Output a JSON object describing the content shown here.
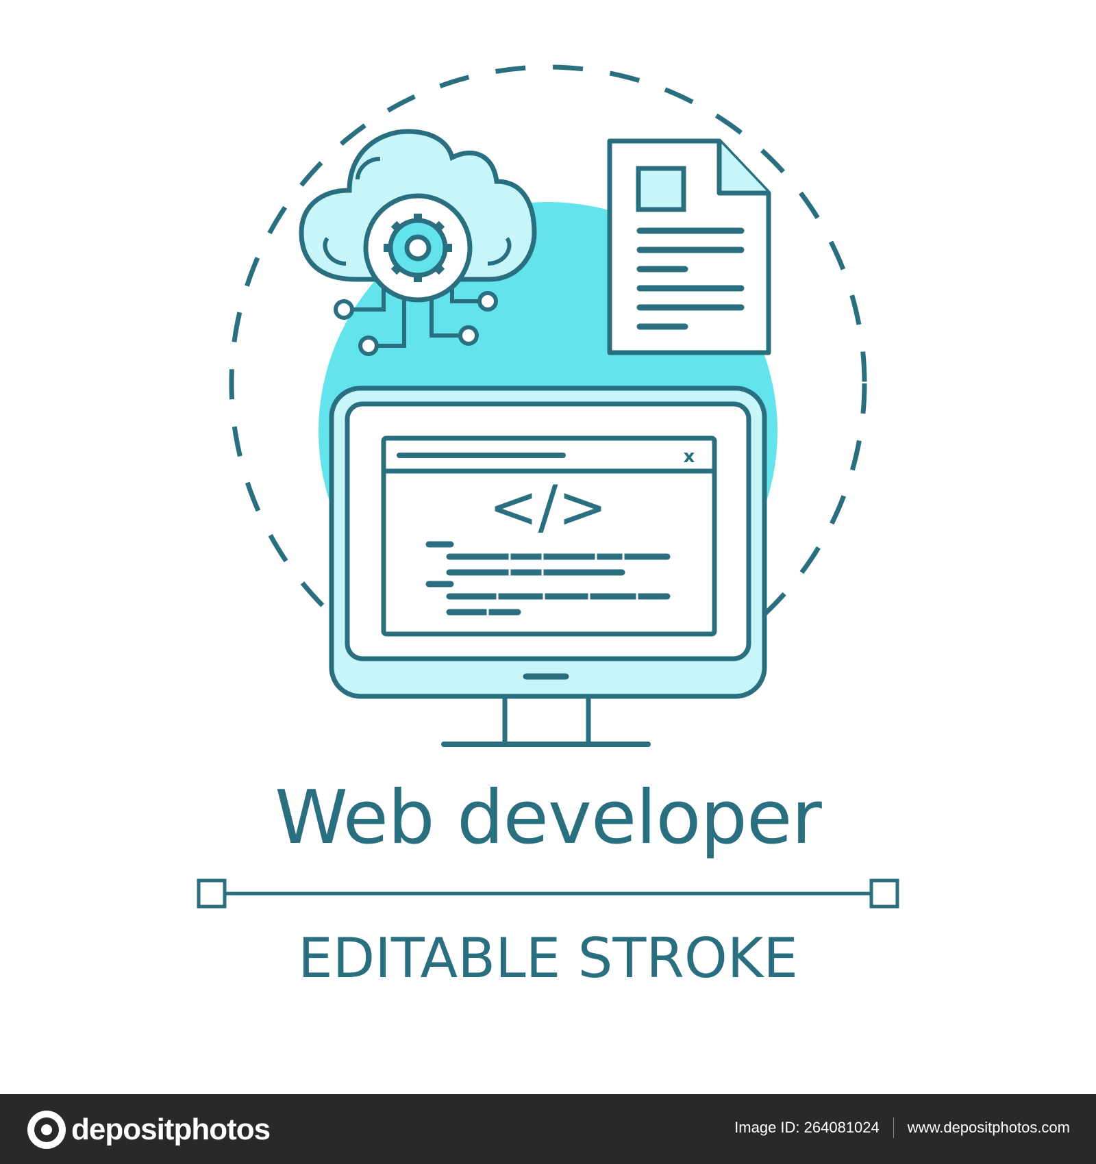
{
  "colors": {
    "stroke": "#2a6f80",
    "accent_fill": "#63e3ec",
    "light_fill": "#c6f6fa",
    "background": "#ffffff",
    "footer_bg": "#292929",
    "footer_text": "#ffffff"
  },
  "illustration": {
    "icons": [
      "cloud-gear-icon",
      "document-icon",
      "monitor-icon",
      "code-brackets-icon",
      "close-icon"
    ],
    "code_symbol": "</>",
    "close_symbol": "x"
  },
  "title": "Web developer",
  "subtitle": "EDITABLE STROKE",
  "footer": {
    "logo_text": "depositphotos",
    "image_id": "Image ID: 264081024",
    "site": "www.depositphotos.com"
  }
}
